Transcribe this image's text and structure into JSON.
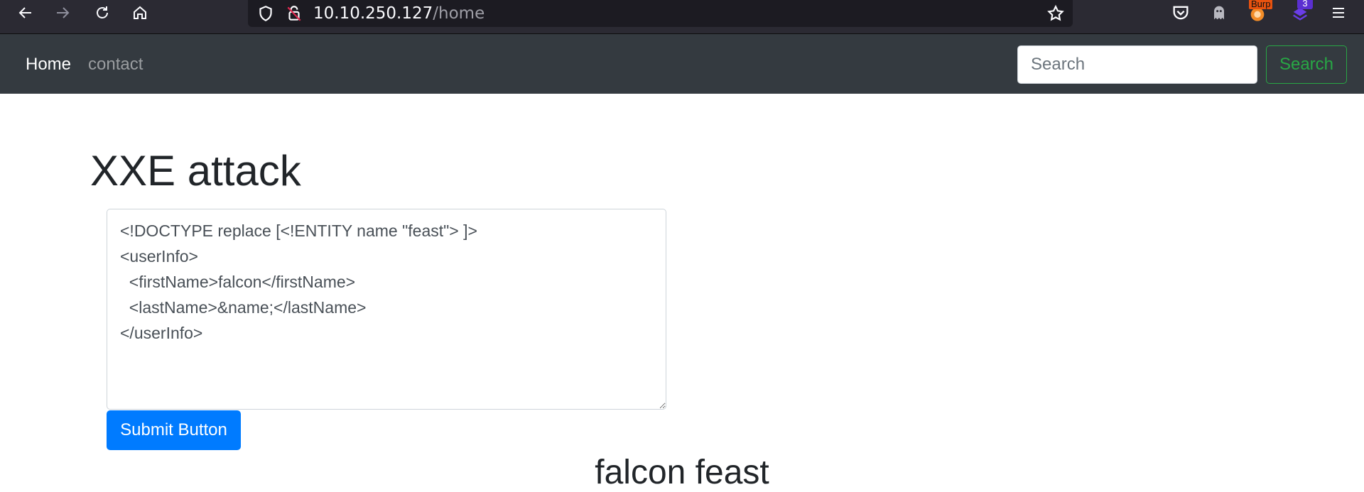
{
  "browser": {
    "url_host": "10.10.250.127",
    "url_path": "/home",
    "burp_label": "Burp",
    "extension_badge": "3"
  },
  "navbar": {
    "home_label": "Home",
    "contact_label": "contact",
    "search_placeholder": "Search",
    "search_button_label": "Search"
  },
  "main": {
    "title": "XXE attack",
    "xml_input": "<!DOCTYPE replace [<!ENTITY name \"feast\"> ]>\n<userInfo>\n  <firstName>falcon</firstName>\n  <lastName>&name;</lastName>\n</userInfo>",
    "submit_label": "Submit Button",
    "result_text": "falcon feast"
  },
  "colors": {
    "navbar_bg": "#343a40",
    "primary": "#007bff",
    "success": "#28a745",
    "browser_bg": "#2b2a33"
  }
}
